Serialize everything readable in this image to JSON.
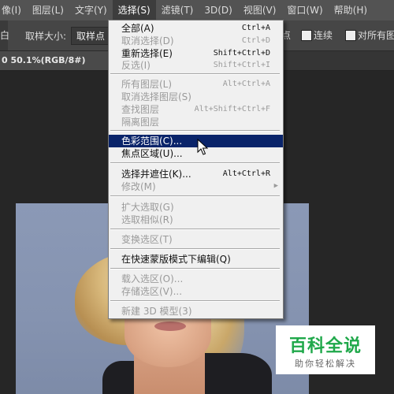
{
  "menubar": {
    "items": [
      "像(I)",
      "图层(L)",
      "文字(Y)",
      "选择(S)",
      "滤镜(T)",
      "3D(D)",
      "视图(V)",
      "窗口(W)",
      "帮助(H)"
    ],
    "active_index": 3
  },
  "options": {
    "tool_end": "白",
    "sample_size_label": "取样大小:",
    "sample_size_value": "取样点",
    "frag": "点",
    "contiguous": "连续",
    "all_layers": "对所有图"
  },
  "document": {
    "tab_title": "0 50.1%(RGB/8#)"
  },
  "select_menu": {
    "items": [
      {
        "label": "全部(A)",
        "shortcut": "Ctrl+A",
        "state": "enabled"
      },
      {
        "label": "取消选择(D)",
        "shortcut": "Ctrl+D",
        "state": "disabled"
      },
      {
        "label": "重新选择(E)",
        "shortcut": "Shift+Ctrl+D",
        "state": "enabled"
      },
      {
        "label": "反选(I)",
        "shortcut": "Shift+Ctrl+I",
        "state": "disabled"
      },
      {
        "label": "所有图层(L)",
        "shortcut": "Alt+Ctrl+A",
        "state": "disabled"
      },
      {
        "label": "取消选择图层(S)",
        "shortcut": "",
        "state": "disabled"
      },
      {
        "label": "查找图层",
        "shortcut": "Alt+Shift+Ctrl+F",
        "state": "disabled"
      },
      {
        "label": "隔离图层",
        "shortcut": "",
        "state": "disabled"
      },
      {
        "label": "色彩范围(C)...",
        "shortcut": "",
        "state": "highlighted"
      },
      {
        "label": "焦点区域(U)...",
        "shortcut": "",
        "state": "enabled"
      },
      {
        "label": "选择并遮住(K)...",
        "shortcut": "Alt+Ctrl+R",
        "state": "enabled"
      },
      {
        "label": "修改(M)",
        "shortcut": "",
        "state": "disabled",
        "submenu": true
      },
      {
        "label": "扩大选取(G)",
        "shortcut": "",
        "state": "disabled"
      },
      {
        "label": "选取相似(R)",
        "shortcut": "",
        "state": "disabled"
      },
      {
        "label": "变换选区(T)",
        "shortcut": "",
        "state": "disabled"
      },
      {
        "label": "在快速蒙版模式下编辑(Q)",
        "shortcut": "",
        "state": "enabled"
      },
      {
        "label": "载入选区(O)...",
        "shortcut": "",
        "state": "disabled"
      },
      {
        "label": "存储选区(V)...",
        "shortcut": "",
        "state": "disabled"
      },
      {
        "label": "新建 3D 模型(3)",
        "shortcut": "",
        "state": "disabled"
      }
    ]
  },
  "watermark": {
    "title": "百科全说",
    "subtitle": "助你轻松解决"
  }
}
